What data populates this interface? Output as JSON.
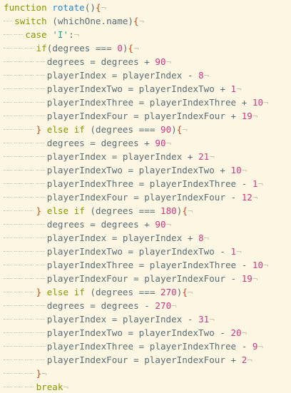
{
  "theme": {
    "background": "#fdf6e3",
    "text": "#586e75",
    "keyword": "#859900",
    "function_name": "#268bd2",
    "number": "#d33682",
    "string": "#2aa198",
    "brace": "#cb4b16",
    "invisible": "#cdc6ad"
  },
  "eol_marker": "¬",
  "lines": [
    {
      "indent": 0,
      "tokens": [
        [
          "kw",
          "function"
        ],
        [
          "plain",
          " "
        ],
        [
          "fn",
          "rotate"
        ],
        [
          "plain",
          "()"
        ],
        [
          "brace",
          "{"
        ]
      ]
    },
    {
      "indent": 1,
      "tokens": [
        [
          "kw",
          "switch"
        ],
        [
          "plain",
          " (whichOne.name)"
        ],
        [
          "brace",
          "{"
        ]
      ]
    },
    {
      "indent": 2,
      "tokens": [
        [
          "kw",
          "case"
        ],
        [
          "plain",
          " "
        ],
        [
          "str",
          "'I'"
        ],
        [
          "plain",
          ":"
        ]
      ]
    },
    {
      "indent": 3,
      "tokens": [
        [
          "kw",
          "if"
        ],
        [
          "plain",
          "(degrees === "
        ],
        [
          "num",
          "0"
        ],
        [
          "plain",
          ")"
        ],
        [
          "brace",
          "{"
        ]
      ]
    },
    {
      "indent": 4,
      "tokens": [
        [
          "plain",
          "degrees = degrees + "
        ],
        [
          "num",
          "90"
        ]
      ]
    },
    {
      "indent": 4,
      "tokens": [
        [
          "plain",
          "playerIndex = playerIndex - "
        ],
        [
          "num",
          "8"
        ]
      ]
    },
    {
      "indent": 4,
      "tokens": [
        [
          "plain",
          "playerIndexTwo = playerIndexTwo + "
        ],
        [
          "num",
          "1"
        ]
      ]
    },
    {
      "indent": 4,
      "tokens": [
        [
          "plain",
          "playerIndexThree = playerIndexThree + "
        ],
        [
          "num",
          "10"
        ]
      ]
    },
    {
      "indent": 4,
      "tokens": [
        [
          "plain",
          "playerIndexFour = playerIndexFour + "
        ],
        [
          "num",
          "19"
        ]
      ]
    },
    {
      "indent": 3,
      "tokens": [
        [
          "brace",
          "}"
        ],
        [
          "plain",
          " "
        ],
        [
          "kw",
          "else if"
        ],
        [
          "plain",
          " (degrees === "
        ],
        [
          "num",
          "90"
        ],
        [
          "plain",
          ")"
        ],
        [
          "brace",
          "{"
        ]
      ]
    },
    {
      "indent": 4,
      "tokens": [
        [
          "plain",
          "degrees = degrees + "
        ],
        [
          "num",
          "90"
        ]
      ]
    },
    {
      "indent": 4,
      "tokens": [
        [
          "plain",
          "playerIndex = playerIndex + "
        ],
        [
          "num",
          "21"
        ]
      ]
    },
    {
      "indent": 4,
      "tokens": [
        [
          "plain",
          "playerIndexTwo = playerIndexTwo + "
        ],
        [
          "num",
          "10"
        ]
      ]
    },
    {
      "indent": 4,
      "tokens": [
        [
          "plain",
          "playerIndexThree = playerIndexThree - "
        ],
        [
          "num",
          "1"
        ]
      ]
    },
    {
      "indent": 4,
      "tokens": [
        [
          "plain",
          "playerIndexFour = playerIndexFour - "
        ],
        [
          "num",
          "12"
        ]
      ]
    },
    {
      "indent": 3,
      "tokens": [
        [
          "brace",
          "}"
        ],
        [
          "plain",
          " "
        ],
        [
          "kw",
          "else if"
        ],
        [
          "plain",
          " (degrees === "
        ],
        [
          "num",
          "180"
        ],
        [
          "plain",
          ")"
        ],
        [
          "brace",
          "{"
        ]
      ]
    },
    {
      "indent": 4,
      "tokens": [
        [
          "plain",
          "degrees = degrees + "
        ],
        [
          "num",
          "90"
        ]
      ]
    },
    {
      "indent": 4,
      "tokens": [
        [
          "plain",
          "playerIndex = playerIndex + "
        ],
        [
          "num",
          "8"
        ]
      ]
    },
    {
      "indent": 4,
      "tokens": [
        [
          "plain",
          "playerIndexTwo = playerIndexTwo - "
        ],
        [
          "num",
          "1"
        ]
      ]
    },
    {
      "indent": 4,
      "tokens": [
        [
          "plain",
          "playerIndexThree = playerIndexThree - "
        ],
        [
          "num",
          "10"
        ]
      ]
    },
    {
      "indent": 4,
      "tokens": [
        [
          "plain",
          "playerIndexFour = playerIndexFour - "
        ],
        [
          "num",
          "19"
        ]
      ]
    },
    {
      "indent": 3,
      "tokens": [
        [
          "brace",
          "}"
        ],
        [
          "plain",
          " "
        ],
        [
          "kw",
          "else if"
        ],
        [
          "plain",
          " (degrees === "
        ],
        [
          "num",
          "270"
        ],
        [
          "plain",
          ")"
        ],
        [
          "brace",
          "{"
        ]
      ]
    },
    {
      "indent": 4,
      "tokens": [
        [
          "plain",
          "degrees = degrees - "
        ],
        [
          "num",
          "270"
        ]
      ]
    },
    {
      "indent": 4,
      "tokens": [
        [
          "plain",
          "playerIndex = playerIndex - "
        ],
        [
          "num",
          "31"
        ]
      ]
    },
    {
      "indent": 4,
      "tokens": [
        [
          "plain",
          "playerIndexTwo = playerIndexTwo - "
        ],
        [
          "num",
          "20"
        ]
      ]
    },
    {
      "indent": 4,
      "tokens": [
        [
          "plain",
          "playerIndexThree = playerIndexThree - "
        ],
        [
          "num",
          "9"
        ]
      ]
    },
    {
      "indent": 4,
      "tokens": [
        [
          "plain",
          "playerIndexFour = playerIndexFour + "
        ],
        [
          "num",
          "2"
        ]
      ]
    },
    {
      "indent": 3,
      "tokens": [
        [
          "brace",
          "}"
        ]
      ]
    },
    {
      "indent": 3,
      "tokens": [
        [
          "kw",
          "break"
        ]
      ]
    }
  ]
}
